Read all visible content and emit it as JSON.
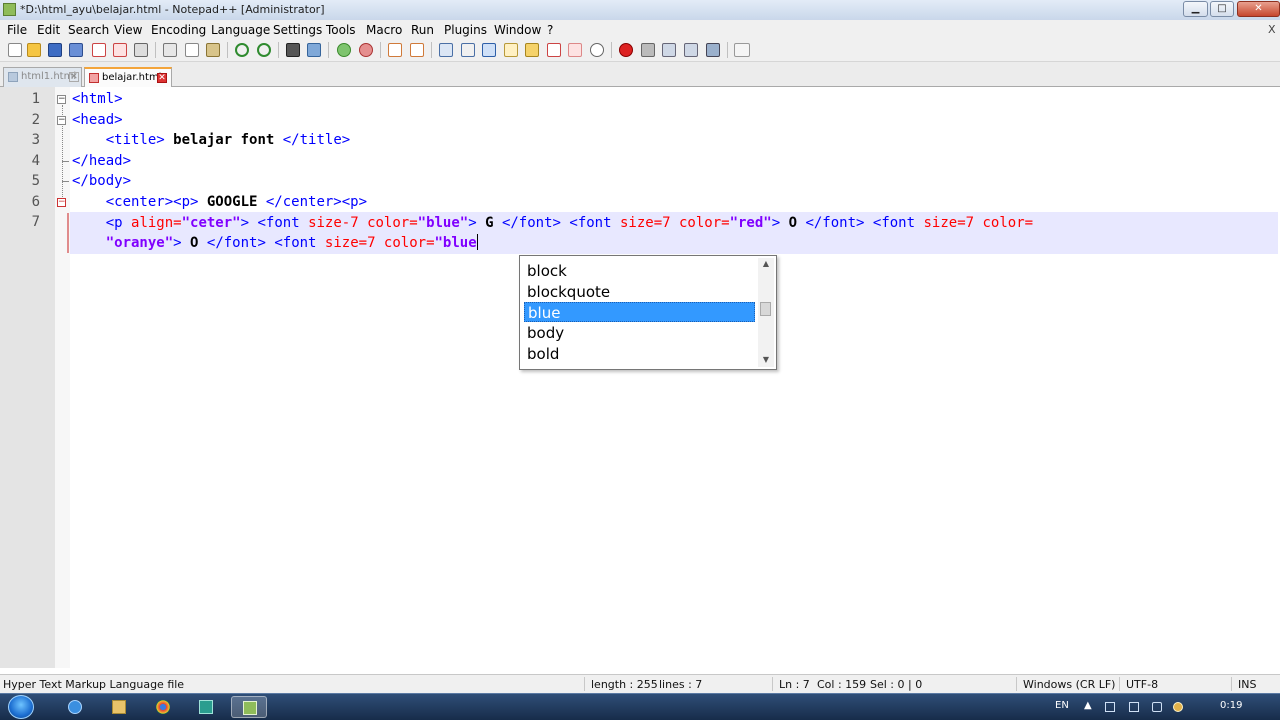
{
  "window": {
    "title": "*D:\\html_ayu\\belajar.html - Notepad++ [Administrator]",
    "min_label": "▁",
    "max_label": "□",
    "close_label": "✕"
  },
  "menu": {
    "items": [
      "File",
      "Edit",
      "Search",
      "View",
      "Encoding",
      "Language",
      "Settings",
      "Tools",
      "Macro",
      "Run",
      "Plugins",
      "Window",
      "?"
    ],
    "close_doc": "X"
  },
  "toolbar": {
    "icons": [
      "new-file-icon",
      "open-file-icon",
      "save-icon",
      "save-all-icon",
      "close-icon",
      "close-all-icon",
      "print-icon",
      "cut-icon",
      "copy-icon",
      "paste-icon",
      "undo-icon",
      "redo-icon",
      "find-icon",
      "replace-icon",
      "zoom-in-icon",
      "zoom-out-icon",
      "sync-vertical-icon",
      "sync-horizontal-icon",
      "word-wrap-icon",
      "show-all-chars-icon",
      "indent-guide-icon",
      "doc-map-icon",
      "function-list-icon",
      "folder-as-workspace-icon",
      "monitoring-icon",
      "record-macro-icon",
      "stop-macro-icon",
      "play-macro-icon",
      "run-macro-multiple-icon",
      "save-macro-icon",
      "spell-check-icon"
    ]
  },
  "tabs": [
    {
      "label": "html1.html",
      "active": false
    },
    {
      "label": "belajar.html",
      "active": true
    }
  ],
  "editor": {
    "line_numbers": [
      "1",
      "2",
      "3",
      "4",
      "5",
      "6",
      "7"
    ],
    "lines": {
      "l1": "<html>",
      "l2": "<head>",
      "l3_open": "<title>",
      "l3_text": " belajar font ",
      "l3_close": "</title>",
      "l4": "</head>",
      "l5": "</body>",
      "l6_tags": "<center><p>",
      "l6_text": " GOOGLE ",
      "l6_close": "</center><p>",
      "l7a_p": "<p ",
      "l7a_align": "align=",
      "l7a_alignv": "\"ceter\"",
      "l7a_gt": ">",
      "l7a_f1": " <font ",
      "l7a_f1attr": "size-7 color=",
      "l7a_f1v": "\"blue\"",
      "l7a_f1gt": ">",
      "l7a_g": " G ",
      "l7a_f1c": "</font>",
      "l7a_f2": " <font ",
      "l7a_f2attr": "size=7 color=",
      "l7a_f2v": "\"red\"",
      "l7a_f2gt": ">",
      "l7a_o": " O ",
      "l7a_f2c": "</font>",
      "l7a_f3": " <font ",
      "l7a_f3attr": "size=7 color=",
      "l7b_f3v": "\"oranye\"",
      "l7b_f3gt": ">",
      "l7b_o": " O ",
      "l7b_f3c": "</font>",
      "l7b_f4": " <font ",
      "l7b_f4attr": "size=7 color=",
      "l7b_f4v": "\"blue"
    }
  },
  "autocomplete": {
    "items": [
      "block",
      "blockquote",
      "blue",
      "body",
      "bold"
    ],
    "selected": "blue"
  },
  "status": {
    "file_type": "Hyper Text Markup Language file",
    "length": "length : 255",
    "lines": "lines : 7",
    "ln": "Ln : 7",
    "col": "Col : 159",
    "sel": "Sel : 0 | 0",
    "eol": "Windows (CR LF)",
    "encoding": "UTF-8",
    "mode": "INS"
  },
  "taskbar": {
    "lang": "EN",
    "time": "0:19"
  },
  "colors": {
    "tag": "#0000ff",
    "attribute": "#ff0000",
    "value": "#8000ff",
    "current_line": "#e8e8ff",
    "selection": "#3399ff"
  }
}
